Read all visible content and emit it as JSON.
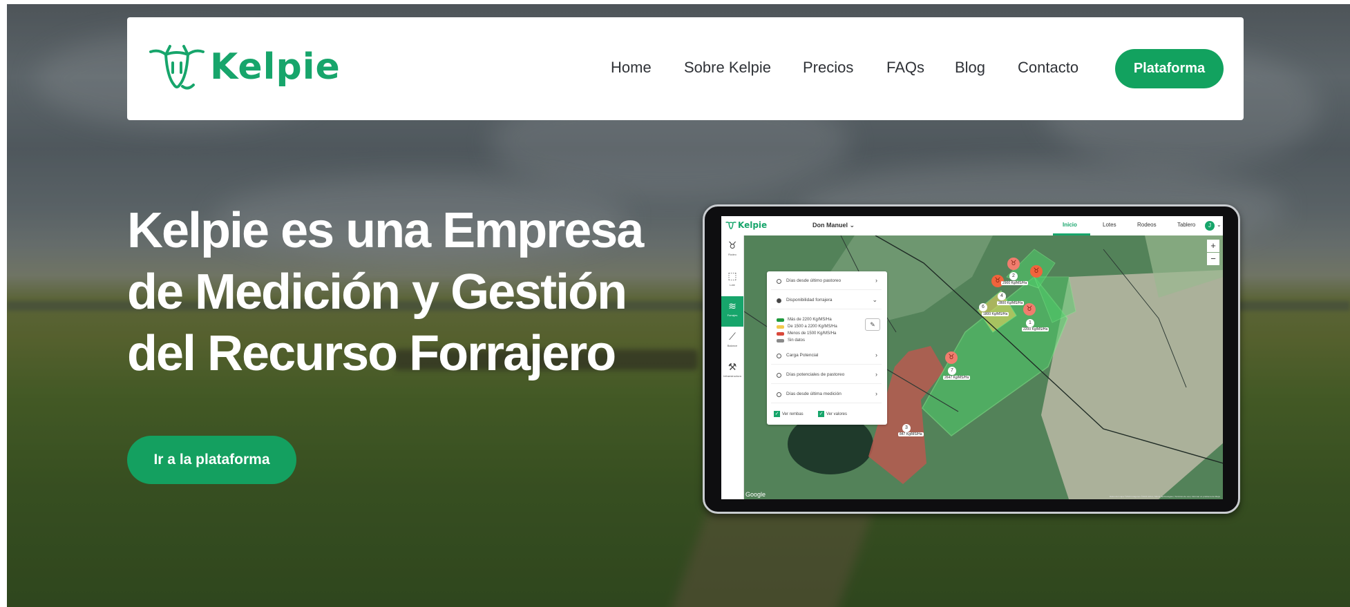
{
  "brand": {
    "name": "Kelpie",
    "color": "#17a56b"
  },
  "nav": {
    "links": [
      "Home",
      "Sobre Kelpie",
      "Precios",
      "FAQs",
      "Blog",
      "Contacto"
    ],
    "cta": "Plataforma"
  },
  "hero": {
    "title_lines": [
      "Kelpie es una Empresa",
      "de Medición y Gestión",
      "del Recurso Forrajero"
    ],
    "cta": "Ir a la plataforma"
  },
  "app": {
    "logo_text": "Kelpie",
    "farm": "Don Manuel",
    "tabs": [
      "Inicio",
      "Lotes",
      "Rodeos",
      "Tablero"
    ],
    "avatar": "J",
    "sidebar": [
      "Rodeo",
      "Lote",
      "Forrajes",
      "Balance",
      "Infraestructura"
    ],
    "layers": [
      "Días desde último pastoreo",
      "Disponibilidad forrajera",
      "Carga Potencial",
      "Días potenciales de pastoreo",
      "Días desde última medición"
    ],
    "legend": [
      {
        "label": "Más de 2200 Kg/MS/Ha",
        "color": "#1f9a3d"
      },
      {
        "label": "De 1500 a 2200 Kg/MS/Ha",
        "color": "#f2c94c"
      },
      {
        "label": "Menos de 1500 Kg/MS/Ha",
        "color": "#d9483b"
      },
      {
        "label": "Sin datos",
        "color": "#8a8a8a"
      }
    ],
    "checkboxes": [
      "Ver rembas",
      "Ver valores"
    ],
    "zoom_in": "+",
    "zoom_out": "−",
    "google": "Google",
    "attribution": "Datos del mapa ©2023 Imágenes ©2023 Airbus, Maxar Technologies | Términos de uso | Informar un problema de Maps",
    "lots": [
      {
        "num": "2",
        "value": "2900 Kg/MS/Ha"
      },
      {
        "num": "4",
        "value": "2800 Kg/MS/Ha"
      },
      {
        "num": "6",
        "value": "1800 Kg/MS/Ha"
      },
      {
        "num": "1",
        "value": "2200 Kg/MS/Ha"
      },
      {
        "num": "7",
        "value": "2647 Kg/MS/Ha"
      },
      {
        "num": "3",
        "value": "847 Kg/MS/Ha"
      }
    ]
  }
}
